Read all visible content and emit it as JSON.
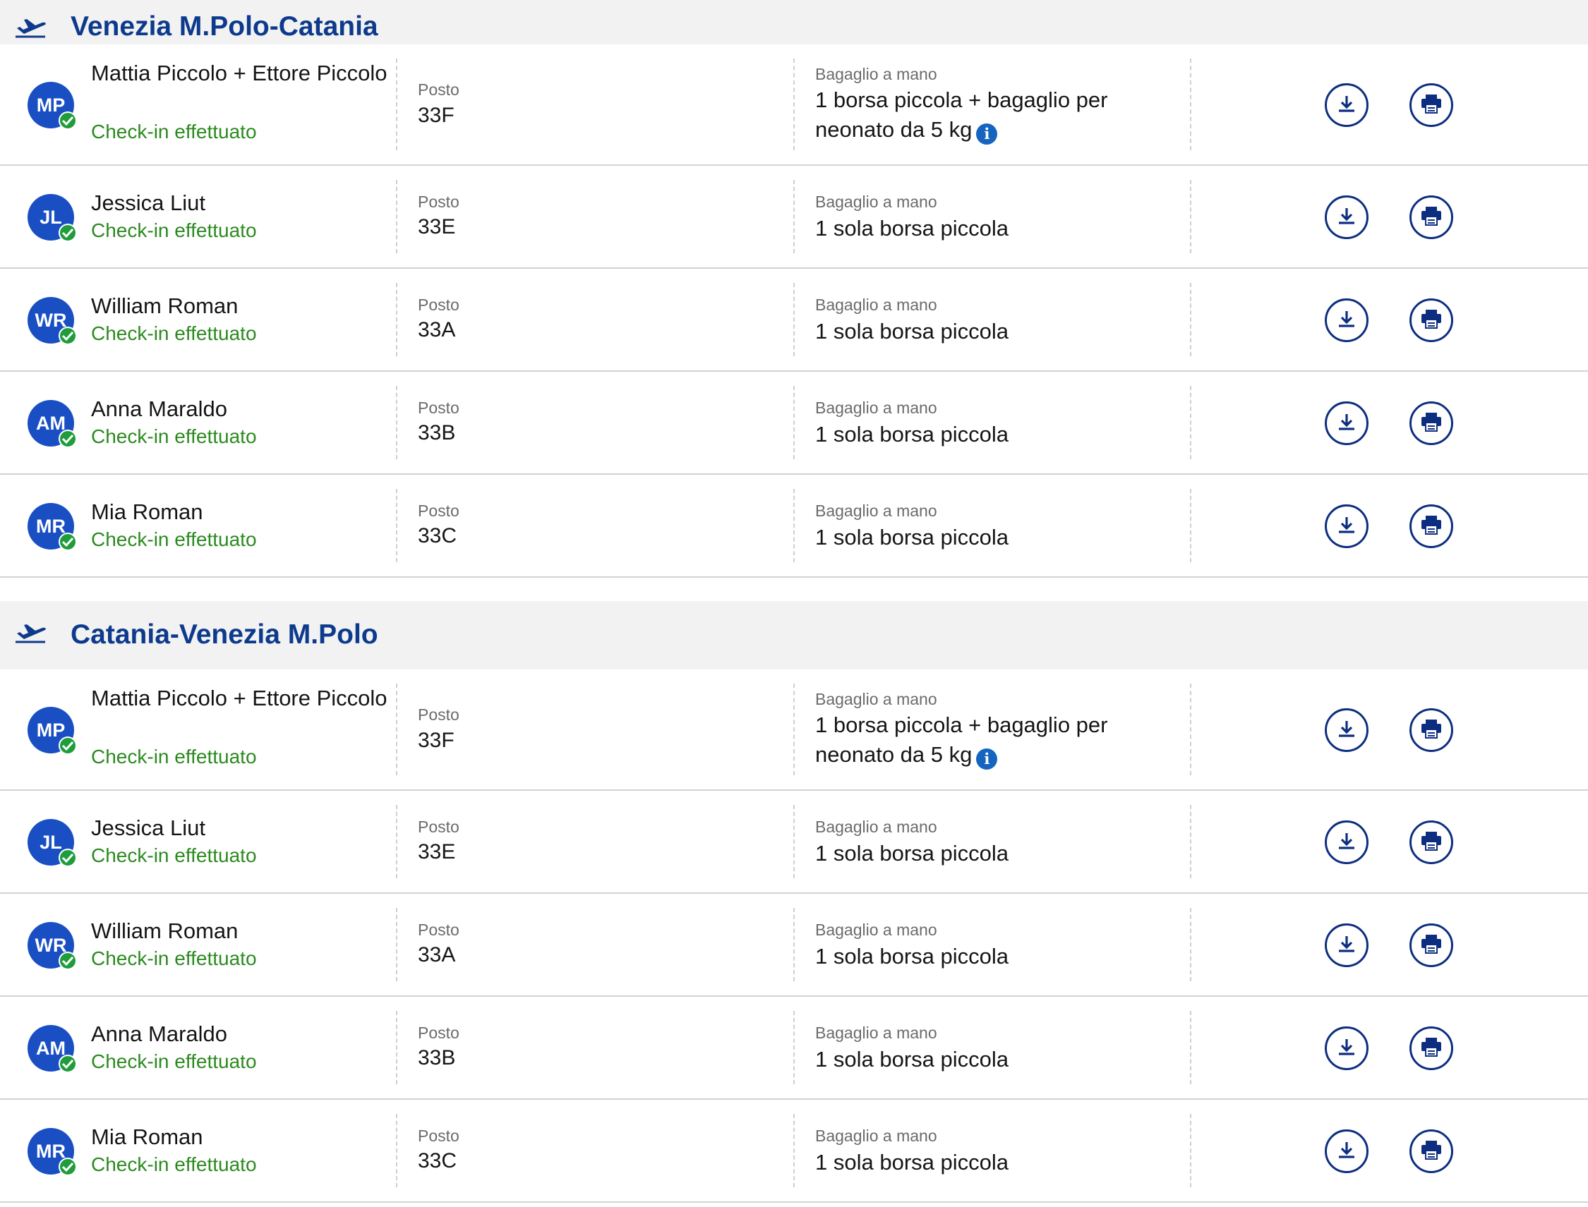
{
  "colors": {
    "accent": "#0d3a8c",
    "avatar": "#1a4fc4",
    "status": "#2b8a1f",
    "check": "#1f9d3a",
    "header_bg": "#f2f2f2",
    "info": "#1565c0"
  },
  "icons": {
    "plane": "airplane-takeoff-icon",
    "download": "download-icon",
    "print": "printer-icon",
    "info": "info-icon",
    "check": "check-icon"
  },
  "flights": [
    {
      "route": "Venezia M.Polo-Catania",
      "passengers": [
        {
          "initials": "MP",
          "name": "Mattia Piccolo + Ettore Piccolo",
          "status": "Check-in effettuato",
          "seat_label": "Posto",
          "seat": "33F",
          "baggage_label": "Bagaglio a mano",
          "baggage": "1 borsa piccola + bagaglio per neonato da 5 kg",
          "info": "i"
        },
        {
          "initials": "JL",
          "name": "Jessica Liut",
          "status": "Check-in effettuato",
          "seat_label": "Posto",
          "seat": "33E",
          "baggage_label": "Bagaglio a mano",
          "baggage": "1 sola borsa piccola"
        },
        {
          "initials": "WR",
          "name": "William Roman",
          "status": "Check-in effettuato",
          "seat_label": "Posto",
          "seat": "33A",
          "baggage_label": "Bagaglio a mano",
          "baggage": "1 sola borsa piccola"
        },
        {
          "initials": "AM",
          "name": "Anna Maraldo",
          "status": "Check-in effettuato",
          "seat_label": "Posto",
          "seat": "33B",
          "baggage_label": "Bagaglio a mano",
          "baggage": "1 sola borsa piccola"
        },
        {
          "initials": "MR",
          "name": "Mia Roman",
          "status": "Check-in effettuato",
          "seat_label": "Posto",
          "seat": "33C",
          "baggage_label": "Bagaglio a mano",
          "baggage": "1 sola borsa piccola"
        }
      ]
    },
    {
      "route": "Catania-Venezia M.Polo",
      "passengers": [
        {
          "initials": "MP",
          "name": "Mattia Piccolo + Ettore Piccolo",
          "status": "Check-in effettuato",
          "seat_label": "Posto",
          "seat": "33F",
          "baggage_label": "Bagaglio a mano",
          "baggage": "1 borsa piccola + bagaglio per neonato da 5 kg",
          "info": "i"
        },
        {
          "initials": "JL",
          "name": "Jessica Liut",
          "status": "Check-in effettuato",
          "seat_label": "Posto",
          "seat": "33E",
          "baggage_label": "Bagaglio a mano",
          "baggage": "1 sola borsa piccola"
        },
        {
          "initials": "WR",
          "name": "William Roman",
          "status": "Check-in effettuato",
          "seat_label": "Posto",
          "seat": "33A",
          "baggage_label": "Bagaglio a mano",
          "baggage": "1 sola borsa piccola"
        },
        {
          "initials": "AM",
          "name": "Anna Maraldo",
          "status": "Check-in effettuato",
          "seat_label": "Posto",
          "seat": "33B",
          "baggage_label": "Bagaglio a mano",
          "baggage": "1 sola borsa piccola"
        },
        {
          "initials": "MR",
          "name": "Mia Roman",
          "status": "Check-in effettuato",
          "seat_label": "Posto",
          "seat": "33C",
          "baggage_label": "Bagaglio a mano",
          "baggage": "1 sola borsa piccola"
        }
      ]
    }
  ]
}
